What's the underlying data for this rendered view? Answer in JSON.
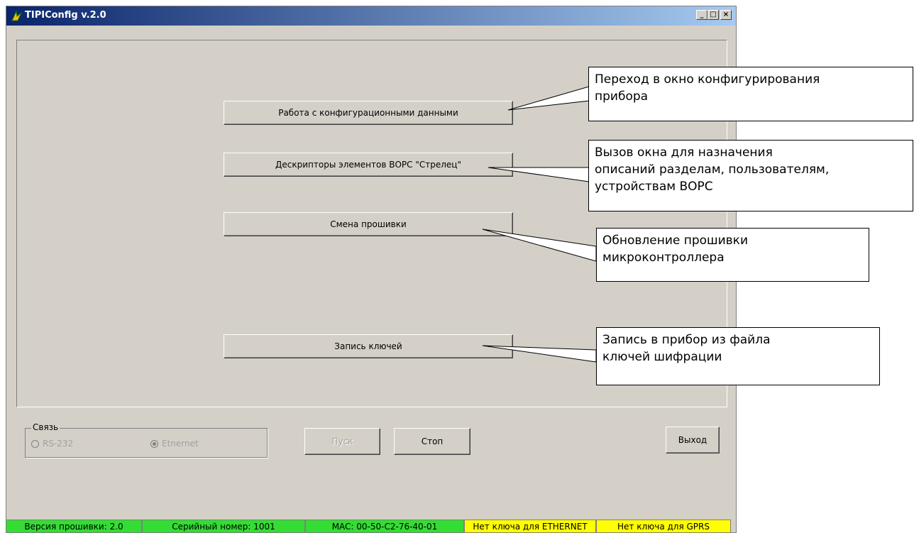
{
  "window": {
    "title": "TIPIConfig v.2.0",
    "controls": [
      "_",
      "□",
      "×"
    ]
  },
  "main_buttons": {
    "config": "Работа с конфигурационными данными",
    "descriptors": "Дескрипторы элементов  ВОРС \"Стрелец\"",
    "firmware": "Смена прошивки",
    "keys": "Запись ключей"
  },
  "connection": {
    "label": "Связь",
    "options": [
      {
        "label": "RS-232",
        "selected": false
      },
      {
        "label": "Etnernet",
        "selected": true
      }
    ]
  },
  "actions": {
    "start": "Пуск",
    "stop": "Стоп",
    "exit": "Выход"
  },
  "status": {
    "firmware_version": "Версия прошивки: 2.0",
    "serial": "Серийный номер: 1001",
    "mac": "MAC: 00-50-C2-76-40-01",
    "ethernet_key": "Нет ключа для ETHERNET",
    "gprs_key": "Нет ключа для GPRS"
  },
  "callouts": {
    "config": [
      "Переход в окно конфигурирования",
      "прибора"
    ],
    "descriptors": [
      "Вызов окна для назначения",
      "описаний разделам, пользователям,",
      "устройствам ВОРС"
    ],
    "firmware": [
      "Обновление прошивки",
      "микроконтроллера"
    ],
    "keys": [
      "Запись в прибор из файла",
      "ключей шифрации"
    ]
  },
  "colors": {
    "title_start": "#0a246a",
    "title_end": "#a6caf0",
    "status_green": "#33dd33",
    "status_yellow": "#ffff00",
    "face": "#d4d0c8"
  }
}
